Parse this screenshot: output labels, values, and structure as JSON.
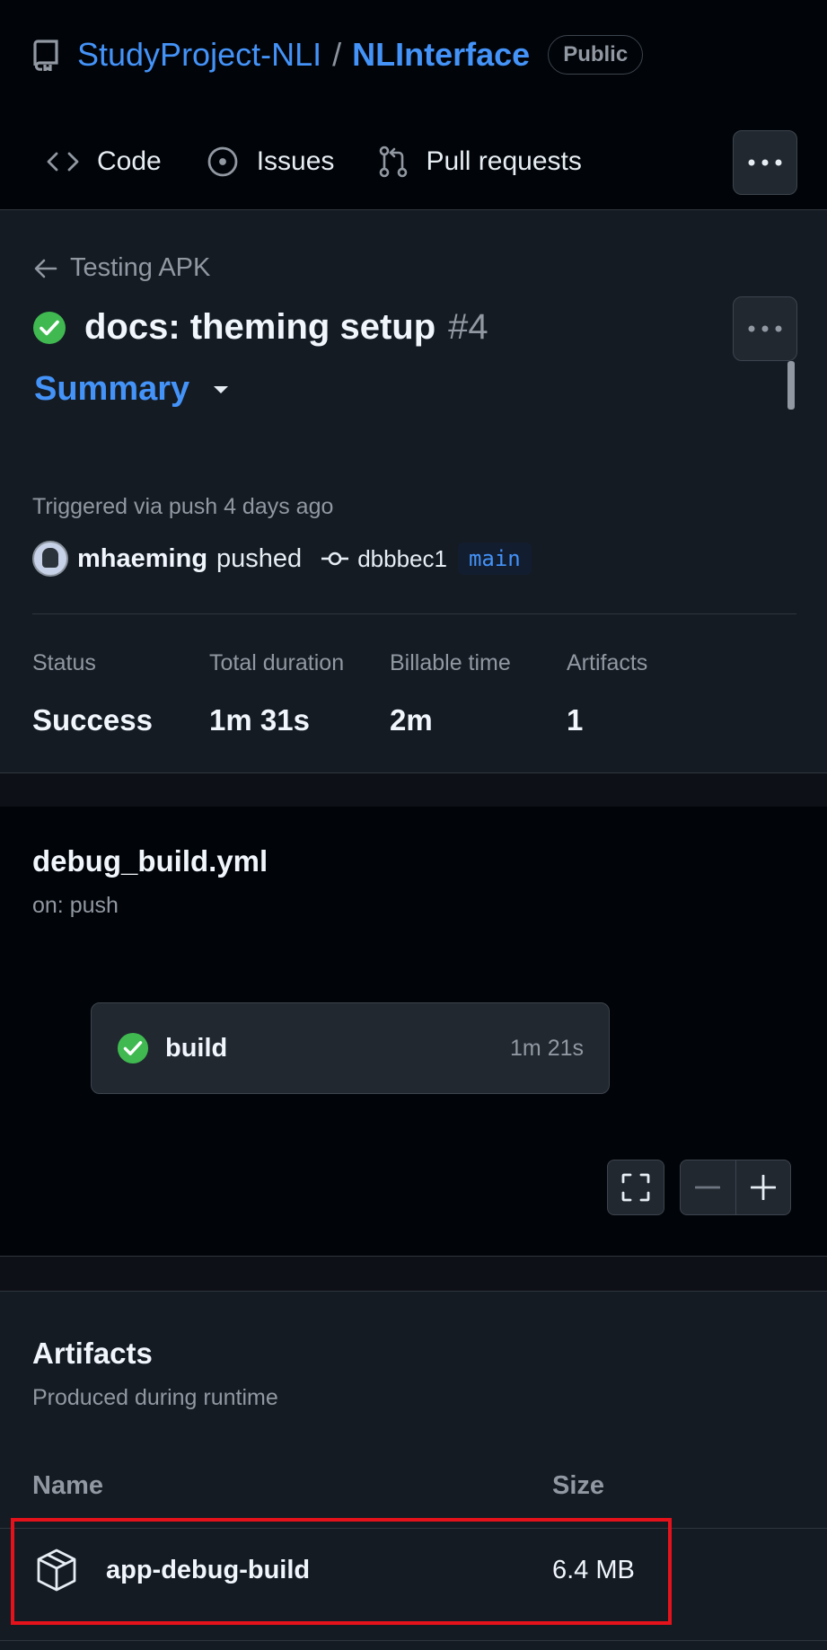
{
  "repo": {
    "owner": "StudyProject-NLI",
    "separator": "/",
    "name": "NLInterface",
    "visibility": "Public"
  },
  "tabs": [
    {
      "label": "Code",
      "icon": "code-icon"
    },
    {
      "label": "Issues",
      "icon": "issue-opened-icon"
    },
    {
      "label": "Pull requests",
      "icon": "git-pull-request-icon"
    }
  ],
  "run": {
    "workflow_name": "Testing APK",
    "title": "docs: theming setup",
    "number": "#4",
    "status_icon": "check-circle-icon",
    "summary_label": "Summary",
    "trigger_text": "Triggered via push 4 days ago",
    "actor": "mhaeming",
    "action": "pushed",
    "commit": "dbbbec1",
    "branch": "main"
  },
  "stats": {
    "status_label": "Status",
    "status_value": "Success",
    "duration_label": "Total duration",
    "duration_value": "1m 31s",
    "billable_label": "Billable time",
    "billable_value": "2m",
    "artifacts_label": "Artifacts",
    "artifacts_value": "1"
  },
  "workflow": {
    "file": "debug_build.yml",
    "trigger": "on: push",
    "job": {
      "name": "build",
      "duration": "1m 21s"
    }
  },
  "artifacts": {
    "title": "Artifacts",
    "subtitle": "Produced during runtime",
    "col_name": "Name",
    "col_size": "Size",
    "items": [
      {
        "name": "app-debug-build",
        "size": "6.4 MB",
        "icon": "package-icon"
      }
    ]
  },
  "colors": {
    "background": "#0d1117",
    "link": "#4493f8",
    "success": "#3fb950",
    "highlight": "#e5121b"
  }
}
